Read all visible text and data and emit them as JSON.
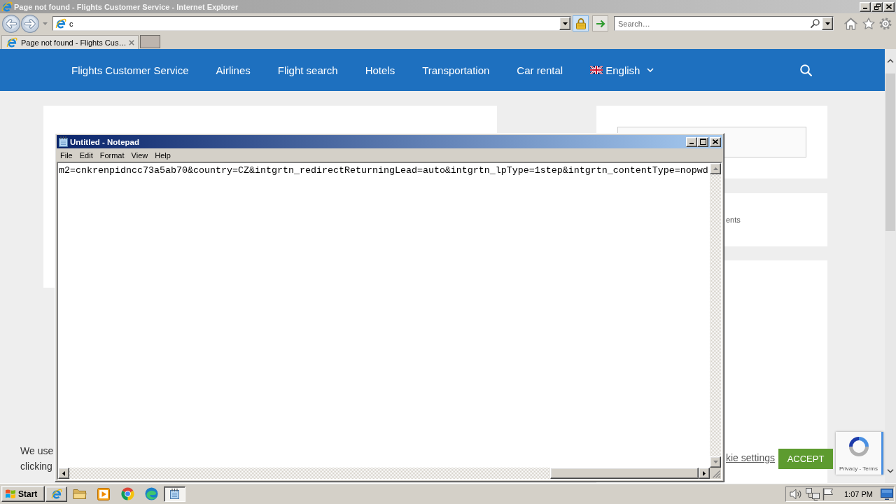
{
  "browser": {
    "title": "Page not found - Flights Customer Service - Internet Explorer",
    "address": "c",
    "search": {
      "placeholder": "Search…"
    },
    "tabs": [
      {
        "label": "Page not found - Flights Cus…",
        "selected": true
      }
    ]
  },
  "site": {
    "nav": [
      "Flights Customer Service",
      "Airlines",
      "Flight search",
      "Hotels",
      "Transportation",
      "Car rental"
    ],
    "language": "English",
    "sidebar_text": "ents"
  },
  "cookie_banner": {
    "lines": [
      "We use",
      "clicking"
    ],
    "settings_link": "kie settings",
    "accept_button": "ACCEPT"
  },
  "recaptcha": {
    "links": "Privacy - Terms"
  },
  "notepad": {
    "title": "Untitled - Notepad",
    "menu": [
      "File",
      "Edit",
      "Format",
      "View",
      "Help"
    ],
    "text": "m2=cnkrenpidncc73a5ab70&country=CZ&intgrtn_redirectReturningLead=auto&intgrtn_lpType=1step&intgrtn_contentType=nopwd"
  },
  "taskbar": {
    "start": "Start",
    "items": [
      {
        "kind": "window",
        "selected": false
      },
      {
        "kind": "launcher",
        "selected": false
      },
      {
        "kind": "launcher",
        "selected": false
      },
      {
        "kind": "launcher",
        "selected": false
      },
      {
        "kind": "launcher",
        "selected": false
      },
      {
        "kind": "window",
        "selected": true
      }
    ],
    "clock": "1:07 PM"
  }
}
